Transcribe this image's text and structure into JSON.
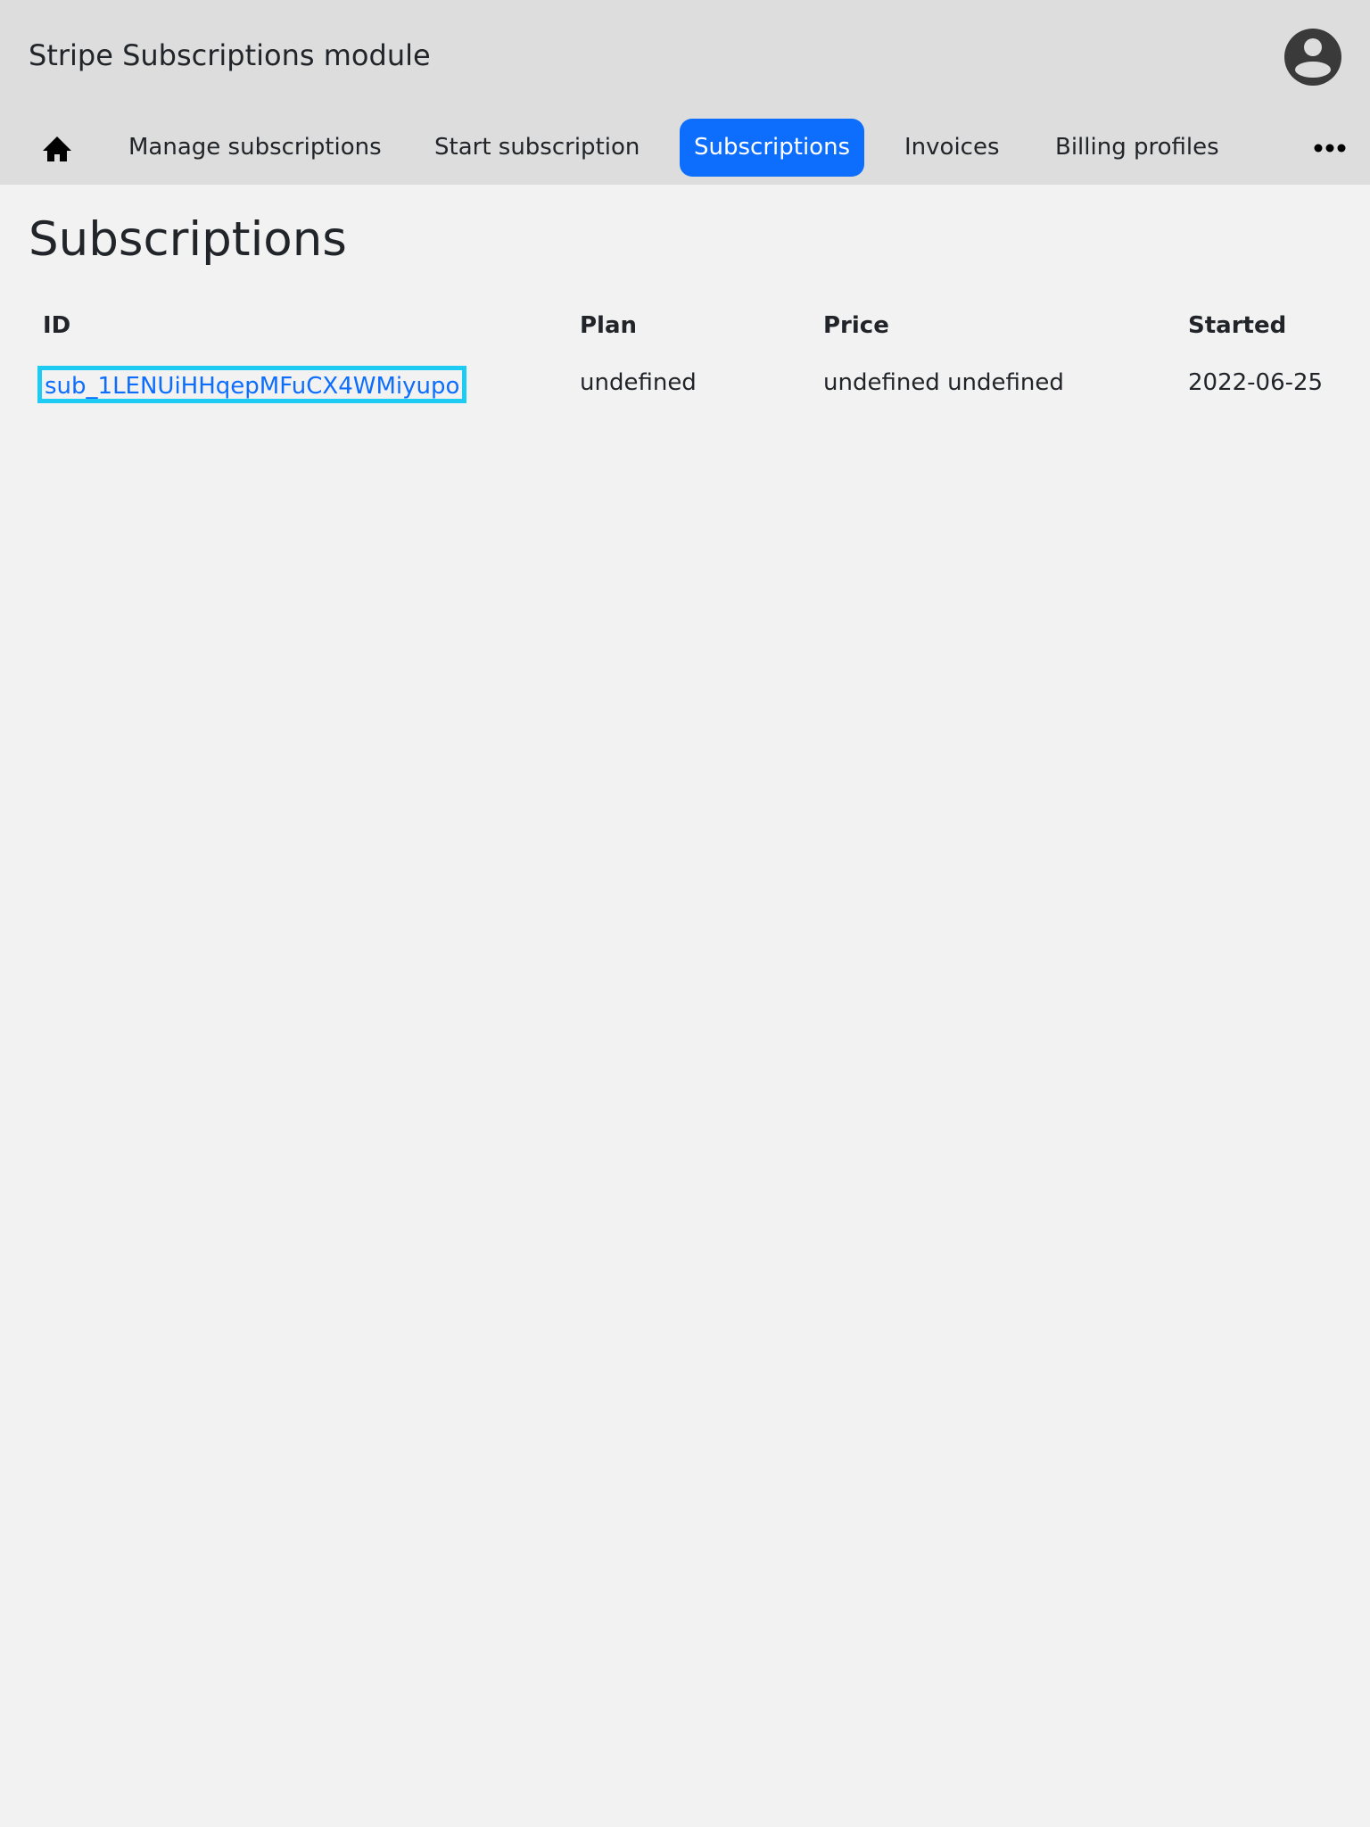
{
  "header": {
    "app_title": "Stripe Subscriptions module"
  },
  "nav": {
    "tabs": [
      {
        "label": "Manage subscriptions"
      },
      {
        "label": "Start subscription"
      },
      {
        "label": "Subscriptions",
        "active": true
      },
      {
        "label": "Invoices"
      },
      {
        "label": "Billing profiles"
      }
    ]
  },
  "main": {
    "title": "Subscriptions",
    "table": {
      "columns": [
        "ID",
        "Plan",
        "Price",
        "Started"
      ],
      "rows": [
        [
          "sub_1LENUiHHqepMFuCX4WMiyupo",
          "undefined",
          "undefined undefined",
          "2022-06-25"
        ]
      ]
    }
  },
  "icons": {
    "home": "home-icon",
    "avatar": "user-avatar-icon",
    "more": "more-horizontal-icon"
  },
  "colors": {
    "header_bg": "#dddddd",
    "page_bg": "#f2f2f2",
    "active_tab": "#0d6efd",
    "link": "#0d6efd",
    "focus_outline": "#1ecbf2"
  }
}
